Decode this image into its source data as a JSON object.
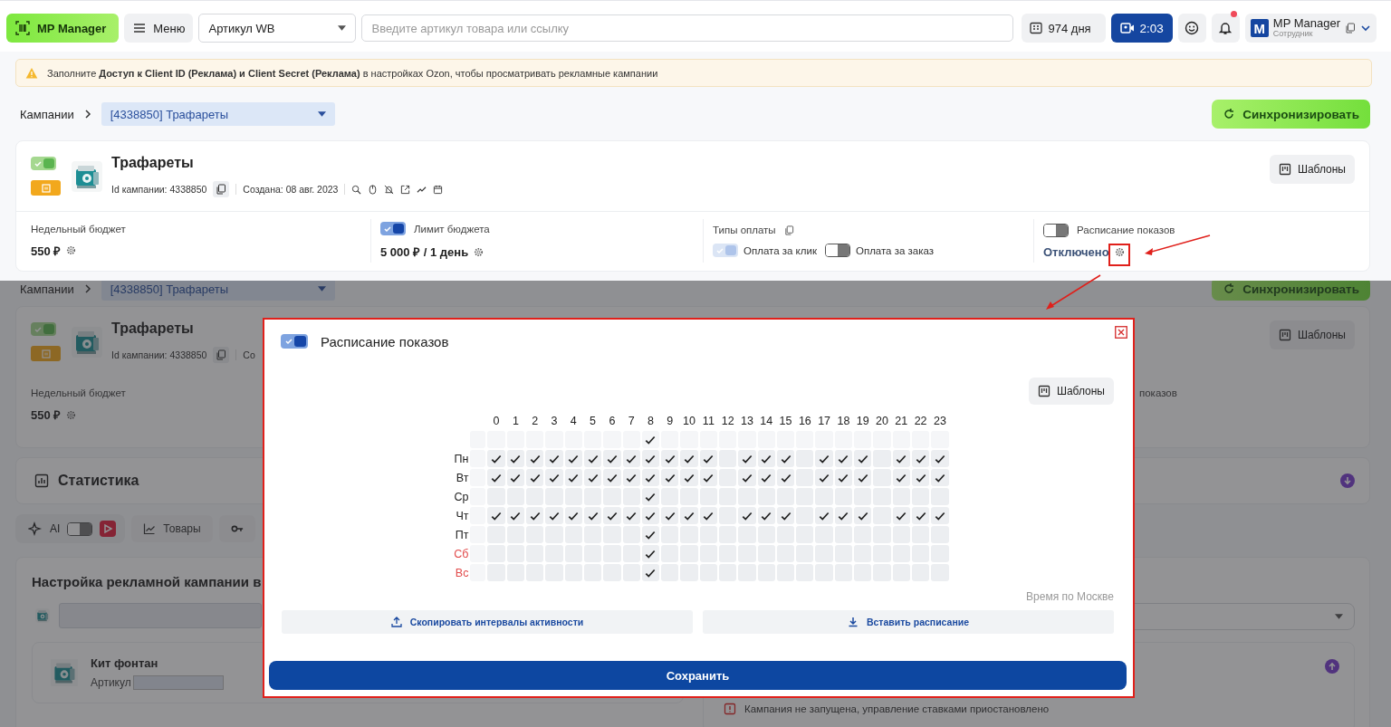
{
  "topbar": {
    "logo": "MP Manager",
    "menu": "Меню",
    "article_select": "Артикул WB",
    "search_placeholder": "Введите артикул товара или ссылку",
    "days": "974 дня",
    "timer": "2:03",
    "notifications_unread": true,
    "user": {
      "avatar": "M",
      "name": "MP Manager",
      "role": "Сотрудник"
    }
  },
  "alert": "Заполните **Доступ к Client ID (Реклама) и Client Secret (Реклама)** в настройках Ozon, чтобы просматривать рекламные кампании",
  "breadcrumb": {
    "root": "Кампании",
    "campaign": "[4338850] Трафареты"
  },
  "sync_button": "Синхронизировать",
  "campaign": {
    "title": "Трафареты",
    "active": true,
    "id_text": "Id кампании: 4338850",
    "created": "Создана: 08 авг. 2023",
    "templates_button": "Шаблоны",
    "weekly_budget": {
      "label": "Недельный бюджет",
      "value": "550 ₽"
    },
    "budget_limit": {
      "label": "Лимит бюджета",
      "on": true,
      "value": "5 000 ₽ / 1 день"
    },
    "payment_types": {
      "label": "Типы оплаты",
      "options": [
        {
          "label": "Оплата за клик",
          "on": true,
          "disabled": true
        },
        {
          "label": "Оплата за заказ",
          "on": false,
          "disabled": false
        }
      ]
    },
    "schedule": {
      "label": "Расписание показов",
      "on": false,
      "value": "Отключено"
    }
  },
  "background_page": {
    "breadcrumb_root": "Кампании",
    "breadcrumb_campaign": "[4338850] Трафареты",
    "sync_button": "Синхронизировать",
    "title": "Трафареты",
    "active": true,
    "id_text": "Id кампании: 4338850",
    "created_fragment": "Со",
    "templates_button": "Шаблоны",
    "weekly_budget_label": "Недельный бюджет",
    "weekly_budget_value": "550 ₽",
    "schedule_label_fragment": "показов",
    "statistics_title": "Статистика",
    "ai_label": "AI",
    "ai_on": false,
    "products_button": "Товары",
    "settings_title": "Настройка рекламной кампании в",
    "product_name": "Кит фонтан",
    "article_label": "Артикул",
    "warning": "Кампания не запущена, управление ставками приостановлено"
  },
  "schedule_dialog": {
    "title": "Расписание показов",
    "on": true,
    "templates_button": "Шаблоны",
    "hours": [
      "0",
      "1",
      "2",
      "3",
      "4",
      "5",
      "6",
      "7",
      "8",
      "9",
      "10",
      "11",
      "12",
      "13",
      "14",
      "15",
      "16",
      "17",
      "18",
      "19",
      "20",
      "21",
      "22",
      "23"
    ],
    "column_toggles": [
      false,
      false,
      false,
      false,
      false,
      false,
      false,
      false,
      true,
      false,
      false,
      false,
      false,
      false,
      false,
      false,
      false,
      false,
      false,
      false,
      false,
      false,
      false,
      false
    ],
    "rows": [
      {
        "day": "Пн",
        "weekend": false,
        "row_select": false,
        "cells": [
          true,
          true,
          true,
          true,
          true,
          true,
          true,
          true,
          true,
          true,
          true,
          true,
          false,
          true,
          true,
          true,
          false,
          true,
          true,
          true,
          false,
          true,
          true,
          true
        ]
      },
      {
        "day": "Вт",
        "weekend": false,
        "row_select": false,
        "cells": [
          true,
          true,
          true,
          true,
          true,
          true,
          true,
          true,
          true,
          true,
          true,
          true,
          false,
          true,
          true,
          true,
          false,
          true,
          true,
          true,
          false,
          true,
          true,
          true
        ]
      },
      {
        "day": "Ср",
        "weekend": false,
        "row_select": false,
        "cells": [
          false,
          false,
          false,
          false,
          false,
          false,
          false,
          false,
          true,
          false,
          false,
          false,
          false,
          false,
          false,
          false,
          false,
          false,
          false,
          false,
          false,
          false,
          false,
          false
        ]
      },
      {
        "day": "Чт",
        "weekend": false,
        "row_select": false,
        "cells": [
          true,
          true,
          true,
          true,
          true,
          true,
          true,
          true,
          true,
          true,
          true,
          true,
          false,
          true,
          true,
          true,
          false,
          true,
          true,
          true,
          false,
          true,
          true,
          true
        ]
      },
      {
        "day": "Пт",
        "weekend": false,
        "row_select": false,
        "cells": [
          false,
          false,
          false,
          false,
          false,
          false,
          false,
          false,
          true,
          false,
          false,
          false,
          false,
          false,
          false,
          false,
          false,
          false,
          false,
          false,
          false,
          false,
          false,
          false
        ]
      },
      {
        "day": "Сб",
        "weekend": true,
        "row_select": false,
        "cells": [
          false,
          false,
          false,
          false,
          false,
          false,
          false,
          false,
          true,
          false,
          false,
          false,
          false,
          false,
          false,
          false,
          false,
          false,
          false,
          false,
          false,
          false,
          false,
          false
        ]
      },
      {
        "day": "Вс",
        "weekend": true,
        "row_select": false,
        "cells": [
          false,
          false,
          false,
          false,
          false,
          false,
          false,
          false,
          true,
          false,
          false,
          false,
          false,
          false,
          false,
          false,
          false,
          false,
          false,
          false,
          false,
          false,
          false,
          false
        ]
      }
    ],
    "timezone_note": "Время по Москве",
    "copy_button": "Скопировать интервалы активности",
    "paste_button": "Вставить расписание",
    "save_button": "Сохранить"
  }
}
